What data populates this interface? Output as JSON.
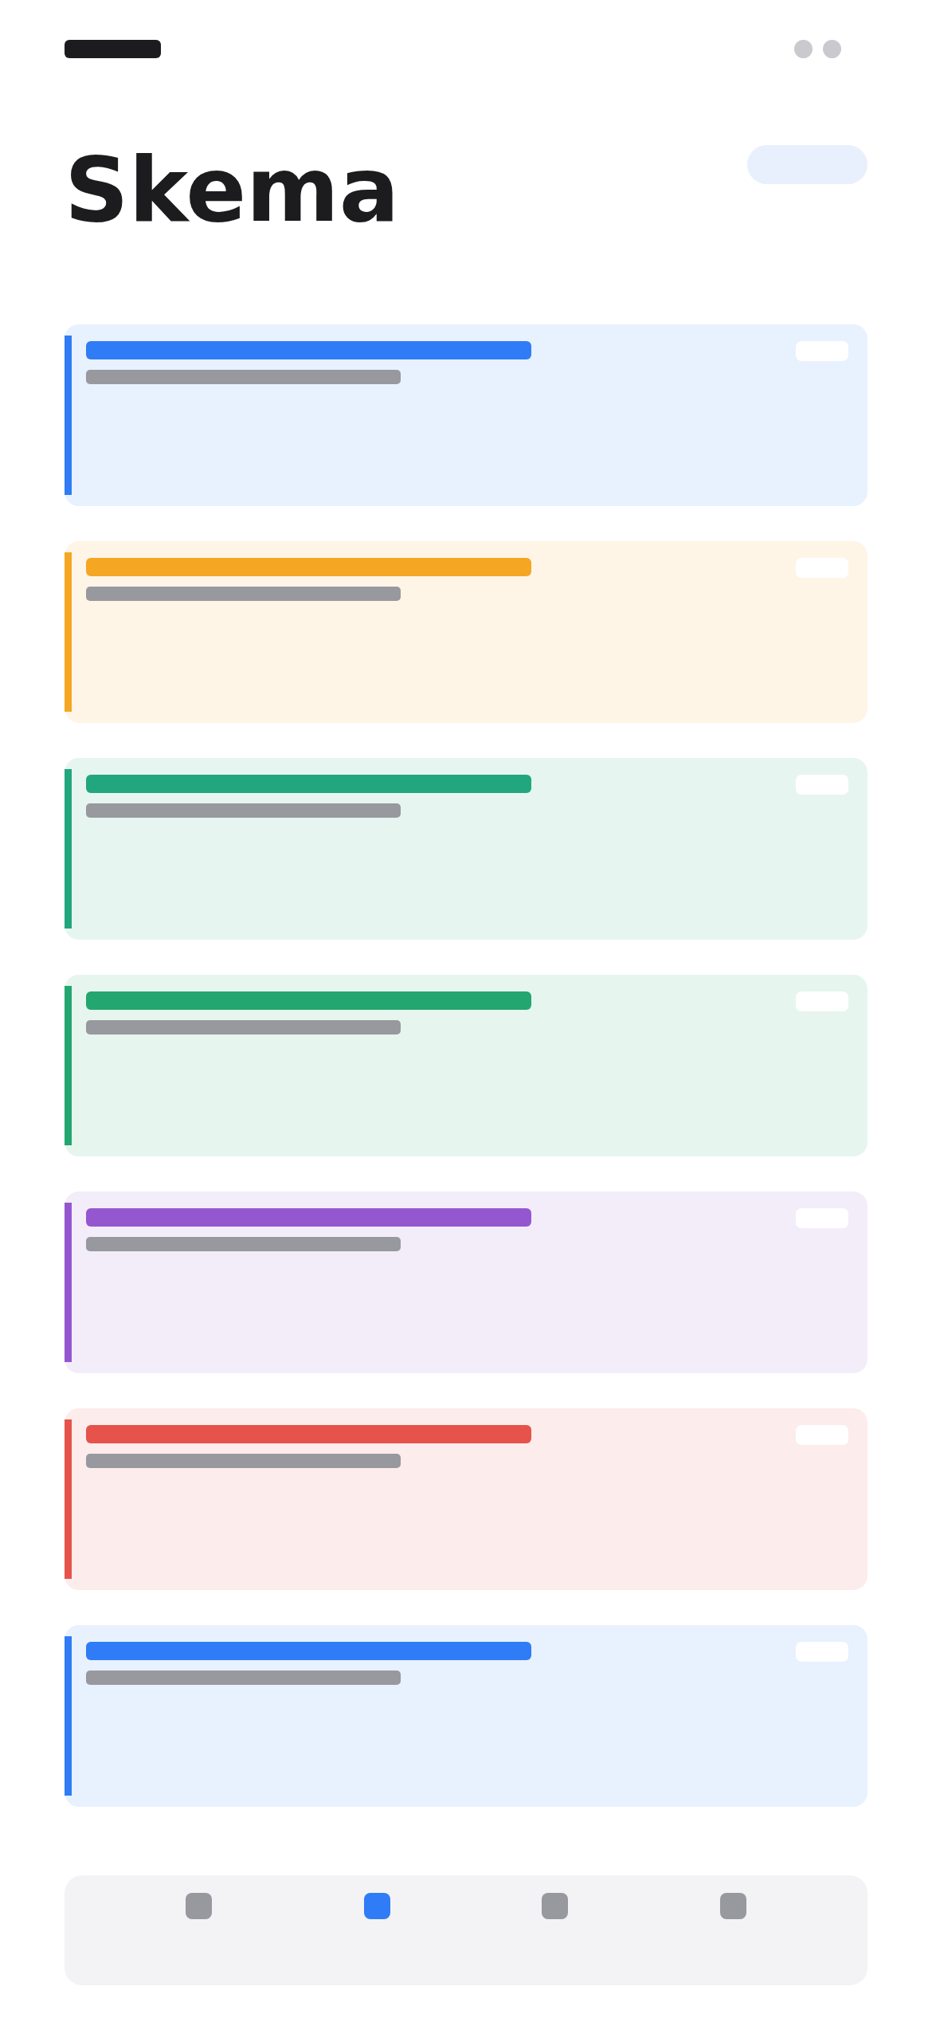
{
  "title": "Skema",
  "cards": [
    {
      "color": "#2f7cf6"
    },
    {
      "color": "#f5a623"
    },
    {
      "color": "#22a67e"
    },
    {
      "color": "#23a66f"
    },
    {
      "color": "#9457d0"
    },
    {
      "color": "#e5534b"
    },
    {
      "color": "#2f7cf6"
    }
  ],
  "nav": [
    {
      "selected": false
    },
    {
      "selected": true
    },
    {
      "selected": false
    },
    {
      "selected": false
    }
  ]
}
